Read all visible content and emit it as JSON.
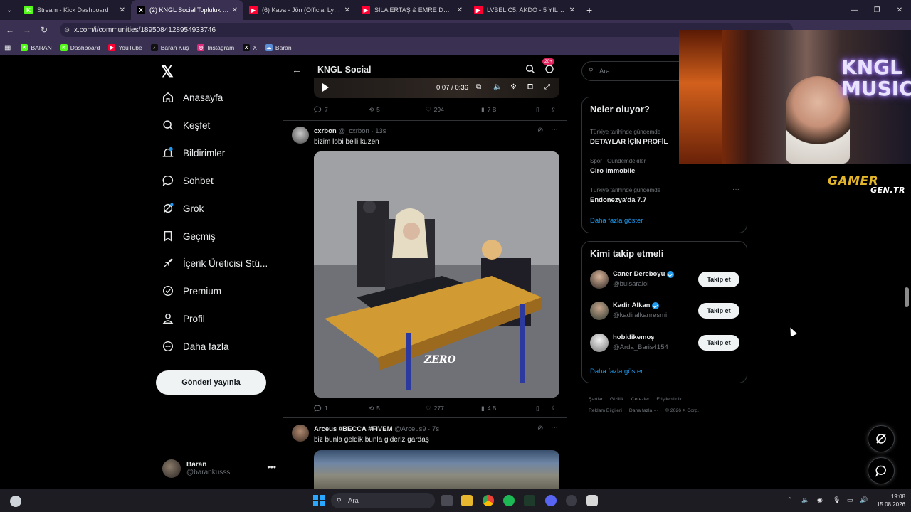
{
  "browser": {
    "tabs": [
      {
        "title": "Stream - Kick Dashboard",
        "fav": "K",
        "color": "#53fc18"
      },
      {
        "title": "(2) KNGL Social Topluluk / X",
        "fav": "X",
        "color": "#000000"
      },
      {
        "title": "(6) Kava - Jön (Official Lyric Vid",
        "fav": "▶",
        "color": "#ff0033"
      },
      {
        "title": "SILA ERTAŞ & EMRE DEMİR - Y",
        "fav": "▶",
        "color": "#ff0033"
      },
      {
        "title": "LVBEL C5, AKDO - 5 YILDIZ - Yo",
        "fav": "▶",
        "color": "#ff0033"
      }
    ],
    "url": "x.com/i/communities/1895084128954933746",
    "bookmarks": [
      {
        "label": "BARAN",
        "fav": "K",
        "color": "#53fc18"
      },
      {
        "label": "Dashboard",
        "fav": "K",
        "color": "#53fc18"
      },
      {
        "label": "YouTube",
        "fav": "▶",
        "color": "#ff0033"
      },
      {
        "label": "Baran Kuş",
        "fav": "♪",
        "color": "#111111"
      },
      {
        "label": "Instagram",
        "fav": "◎",
        "color": "#dd2a7b"
      },
      {
        "label": "X",
        "fav": "X",
        "color": "#111111"
      },
      {
        "label": "Baran",
        "fav": "☁",
        "color": "#5a8fd8"
      }
    ]
  },
  "sidebar": {
    "logo": "𝕏",
    "items": [
      {
        "label": "Anasayfa",
        "icon": "home-icon"
      },
      {
        "label": "Keşfet",
        "icon": "search-icon"
      },
      {
        "label": "Bildirimler",
        "icon": "bell-icon",
        "badge": "2"
      },
      {
        "label": "Sohbet",
        "icon": "chat-icon"
      },
      {
        "label": "Grok",
        "icon": "grok-icon"
      },
      {
        "label": "Geçmiş",
        "icon": "bookmark-icon"
      },
      {
        "label": "İçerik Üreticisi Stü...",
        "icon": "rocket-icon"
      },
      {
        "label": "Premium",
        "icon": "premium-icon"
      },
      {
        "label": "Profil",
        "icon": "profile-icon"
      },
      {
        "label": "Daha fazla",
        "icon": "more-circle-icon"
      }
    ],
    "post_button": "Gönderi yayınla",
    "account": {
      "name": "Baran",
      "handle": "@barankusss"
    }
  },
  "main": {
    "title": "KNGL Social",
    "notif_badge": "20+",
    "video_time": "0:07 / 0:36",
    "tweet0_actions": {
      "replies": "7",
      "retweets": "5",
      "likes": "294",
      "views": "7 B"
    },
    "tweet1": {
      "name": "cxrbon",
      "handle": "@_cxrbon · 13s",
      "text": "bizim lobi belli kuzen",
      "watermark": "ZERO",
      "actions": {
        "replies": "1",
        "retweets": "5",
        "likes": "277",
        "views": "4 B"
      }
    },
    "tweet2": {
      "name": "Arceus #BECCA #FIVEM",
      "handle": "@Arceus9 · 7s",
      "text": "biz bunla geldik bunla gideriz gardaş"
    }
  },
  "right": {
    "search_placeholder": "Ara",
    "trends_title": "Neler oluyor?",
    "trends": [
      {
        "category": "Türkiye tarihinde gündemde",
        "name": "DETAYLAR İÇİN PROFİL"
      },
      {
        "category": "Spor · Gündemdekiler",
        "name": "Ciro Immobile"
      },
      {
        "category": "Türkiye tarihinde gündemde",
        "name": "Endonezya'da 7.7"
      }
    ],
    "show_more": "Daha fazla göster",
    "who_title": "Kimi takip etmeli",
    "who": [
      {
        "name": "Caner Dereboyu",
        "handle": "@bulsaralol",
        "verified": true,
        "button": "Takip et"
      },
      {
        "name": "Kadir Alkan",
        "handle": "@kadiralkanresmi",
        "verified": true,
        "button": "Takip et"
      },
      {
        "name": "hobidikemoş",
        "handle": "@Arda_Baris4154",
        "verified": false,
        "button": "Takip et"
      }
    ],
    "who_more": "Daha fazla göster",
    "footer": [
      "Şartlar",
      "Gizlilik",
      "Çerezler",
      "Erişilebilirlik",
      "Reklam Bilgileri",
      "Daha fazla ···",
      "© 2026 X Corp."
    ]
  },
  "overlay": {
    "webcam_text1": "KNGL",
    "webcam_text2": "MUSIC",
    "gamer_text": "GAMER",
    "gamer_sub": "GEN.TR"
  },
  "taskbar": {
    "search": "Ara",
    "time": "19:08",
    "date": "15.08.2026"
  }
}
